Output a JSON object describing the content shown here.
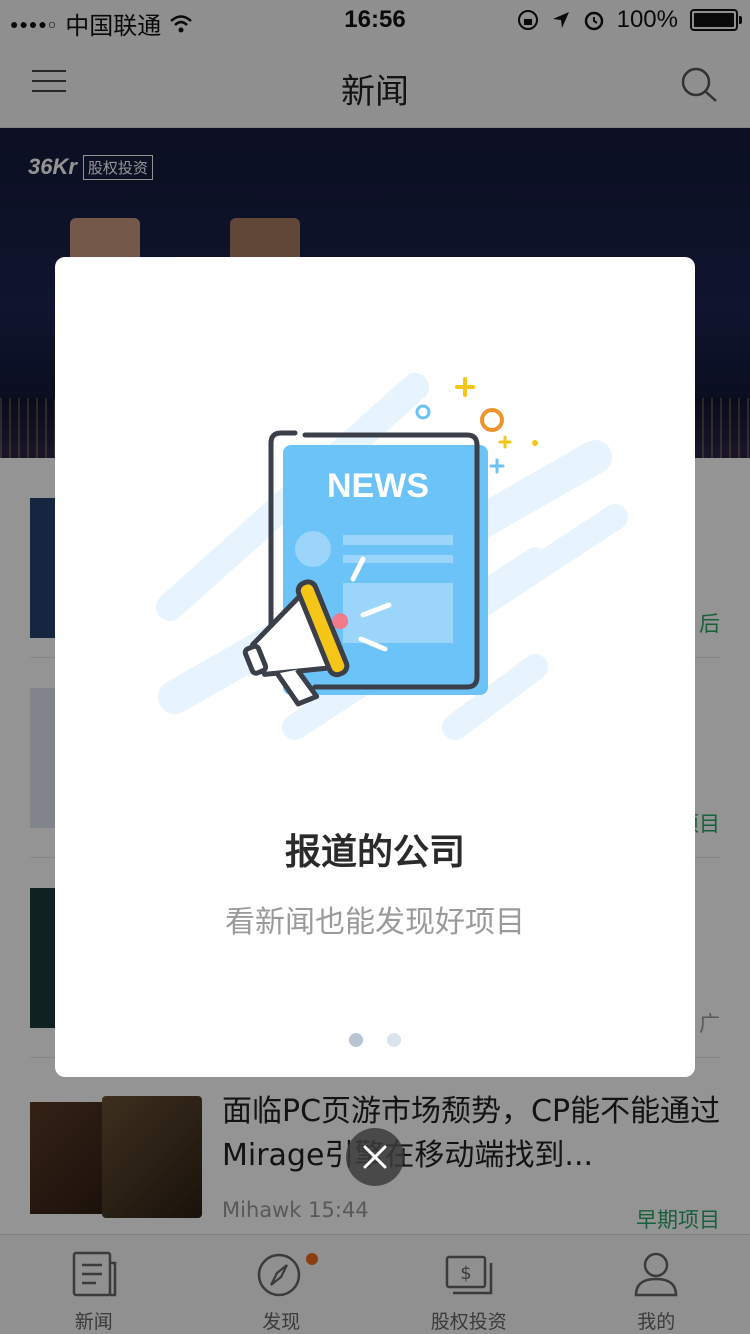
{
  "status_bar": {
    "carrier": "中国联通",
    "time": "16:56",
    "battery_percent": "100%",
    "battery_level": 1.0
  },
  "nav": {
    "title": "新闻"
  },
  "banner": {
    "brand": "36Kr",
    "tag": "股权投资"
  },
  "feed": {
    "items": [
      {
        "tag": "后"
      },
      {
        "tag": "项目"
      },
      {
        "tag": "广"
      },
      {
        "title": "面临PC页游市场颓势，CP能不能通过Mirage引擎在移动端找到...",
        "meta": "Mihawk 15:44",
        "tag": "早期项目"
      }
    ]
  },
  "dialog": {
    "illustration_text": "NEWS",
    "title": "报道的公司",
    "subtitle": "看新闻也能发现好项目",
    "page_indicator": {
      "count": 2,
      "active": 0
    }
  },
  "tabbar": {
    "tabs": [
      {
        "label": "新闻",
        "icon": "news-icon"
      },
      {
        "label": "发现",
        "icon": "compass-icon"
      },
      {
        "label": "股权投资",
        "icon": "investment-icon"
      },
      {
        "label": "我的",
        "icon": "profile-icon"
      }
    ]
  },
  "colors": {
    "accent_green": "#2aa568",
    "badge_orange": "#f06a1a",
    "news_blue": "#6cc3f7",
    "megaphone_yellow": "#f5c518"
  }
}
